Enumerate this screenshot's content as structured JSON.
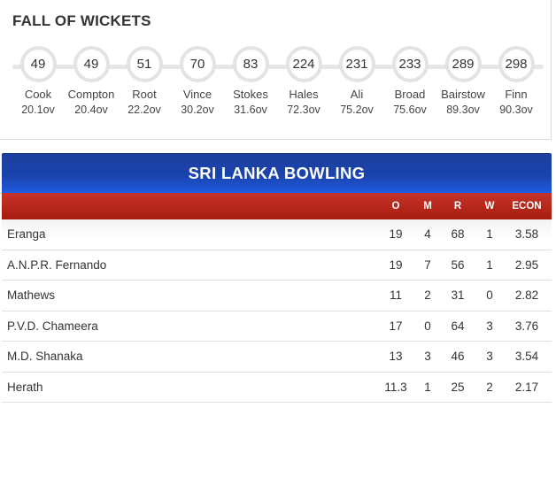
{
  "fall_of_wickets": {
    "title": "FALL OF WICKETS",
    "items": [
      {
        "score": "49",
        "name": "Cook",
        "over": "20.1ov"
      },
      {
        "score": "49",
        "name": "Compton",
        "over": "20.4ov"
      },
      {
        "score": "51",
        "name": "Root",
        "over": "22.2ov"
      },
      {
        "score": "70",
        "name": "Vince",
        "over": "30.2ov"
      },
      {
        "score": "83",
        "name": "Stokes",
        "over": "31.6ov"
      },
      {
        "score": "224",
        "name": "Hales",
        "over": "72.3ov"
      },
      {
        "score": "231",
        "name": "Ali",
        "over": "75.2ov"
      },
      {
        "score": "233",
        "name": "Broad",
        "over": "75.6ov"
      },
      {
        "score": "289",
        "name": "Bairstow",
        "over": "89.3ov"
      },
      {
        "score": "298",
        "name": "Finn",
        "over": "90.3ov"
      }
    ]
  },
  "bowling": {
    "title": "SRI LANKA BOWLING",
    "columns": {
      "o": "O",
      "m": "M",
      "r": "R",
      "w": "W",
      "econ": "ECON"
    },
    "rows": [
      {
        "name": "Eranga",
        "o": "19",
        "m": "4",
        "r": "68",
        "w": "1",
        "econ": "3.58"
      },
      {
        "name": "A.N.P.R. Fernando",
        "o": "19",
        "m": "7",
        "r": "56",
        "w": "1",
        "econ": "2.95"
      },
      {
        "name": "Mathews",
        "o": "11",
        "m": "2",
        "r": "31",
        "w": "0",
        "econ": "2.82"
      },
      {
        "name": "P.V.D. Chameera",
        "o": "17",
        "m": "0",
        "r": "64",
        "w": "3",
        "econ": "3.76"
      },
      {
        "name": "M.D. Shanaka",
        "o": "13",
        "m": "3",
        "r": "46",
        "w": "3",
        "econ": "3.54"
      },
      {
        "name": "Herath",
        "o": "11.3",
        "m": "1",
        "r": "25",
        "w": "2",
        "econ": "2.17"
      }
    ]
  },
  "colors": {
    "header_blue": "#1a43ad",
    "columns_red": "#b8281c",
    "circle_border": "#e3e3e3"
  }
}
